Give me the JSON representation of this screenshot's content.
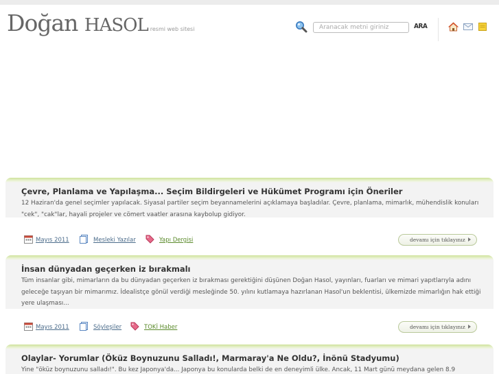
{
  "header": {
    "logo_main_a": "Doğan",
    "logo_main_b": "Hasol",
    "logo_sub": "resmi web sitesi",
    "search_placeholder": "Aranacak metni giriniz",
    "search_button": "ARA"
  },
  "icons": {
    "search": "search-icon",
    "home": "home-icon",
    "mail": "mail-icon",
    "note": "note-icon"
  },
  "articles": [
    {
      "title": "Çevre, Planlama ve Yapılaşma... Seçim Bildirgeleri ve Hükümet Programı için Öneriler",
      "text": "12 Haziran'da genel seçimler yapılacak. Siyasal partiler seçim beyannamelerini açıklamaya başladılar. Çevre, planlama, mimarlık, mühendislik konuları \"cek\", \"cak\"lar, hayali projeler ve cömert vaatler arasına kaybolup gidiyor.",
      "date": "Mayıs 2011",
      "category": "Mesleki Yazılar",
      "tag": "Yapı Dergisi",
      "more": "devamı için tıklayınız"
    },
    {
      "title": "İnsan dünyadan geçerken iz bırakmalı",
      "text": "Tüm insanlar gibi, mimarların da bu dünyadan geçerken iz bırakması gerektiğini düşünen Doğan Hasol, yayınları, fuarları ve mimari yapıtlarıyla adını geleceğe taşıyan bir mimarımız. İdealistçe gönül verdiği mesleğinde 50. yılını kutlamaya hazırlanan Hasol'un beklentisi, ülkemizde mimarlığın hak ettiği yere ulaşması...",
      "date": "Mayıs 2011",
      "category": "Söyleşiler",
      "tag": "TOKİ Haber",
      "more": "devamı için tıklayınız"
    },
    {
      "title": "Olaylar- Yorumlar (Öküz Boynuzunu Salladı!, Marmaray'a Ne Oldu?, İnönü Stadyumu)",
      "text": "Yine \"öküz boynuzunu salladı!\". Bu kez Japonya'da... Japonya bu konularda belki de en deneyimli ülke. Ancak, 11 Mart günü meydana gelen 8.9"
    }
  ],
  "colors": {
    "accent_green": "#cfe29b",
    "link_blue": "#4a6b8a",
    "tag_green": "#5a8a2a"
  }
}
